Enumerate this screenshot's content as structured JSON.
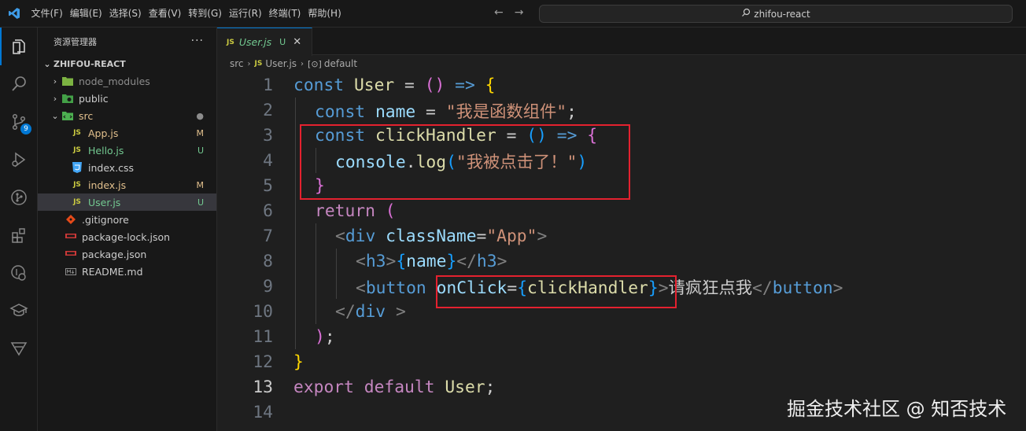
{
  "titlebar": {
    "menu": [
      "文件(F)",
      "编辑(E)",
      "选择(S)",
      "查看(V)",
      "转到(G)",
      "运行(R)",
      "终端(T)",
      "帮助(H)"
    ],
    "search_text": "zhifou-react"
  },
  "activitybar": {
    "source_control_badge": "9"
  },
  "sidebar": {
    "header": "资源管理器",
    "more": "···",
    "section": "ZHIFOU-REACT",
    "items": [
      {
        "label": "node_modules",
        "status": ""
      },
      {
        "label": "public",
        "status": ""
      },
      {
        "label": "src",
        "status": "●"
      },
      {
        "label": "App.js",
        "status": "M"
      },
      {
        "label": "Hello.js",
        "status": "U"
      },
      {
        "label": "index.css",
        "status": ""
      },
      {
        "label": "index.js",
        "status": "M"
      },
      {
        "label": "User.js",
        "status": "U"
      },
      {
        "label": ".gitignore",
        "status": ""
      },
      {
        "label": "package-lock.json",
        "status": ""
      },
      {
        "label": "package.json",
        "status": ""
      },
      {
        "label": "README.md",
        "status": ""
      }
    ]
  },
  "editor": {
    "tab": {
      "icon": "JS",
      "label": "User.js",
      "status": "U"
    },
    "breadcrumb": [
      "src",
      "User.js",
      "default"
    ],
    "line_numbers": [
      "1",
      "2",
      "3",
      "4",
      "5",
      "6",
      "7",
      "8",
      "9",
      "10",
      "11",
      "12",
      "13",
      "14"
    ],
    "code": {
      "l1": {
        "kw": "const",
        "name": "User",
        "eq": " = ",
        "p1": "()",
        "arrow": " => ",
        "brace": "{"
      },
      "l2": {
        "kw": "const",
        "name": "name",
        "eq": " = ",
        "str": "\"我是函数组件\"",
        "semi": ";"
      },
      "l3": {
        "kw": "const",
        "name": "clickHandler",
        "eq": " = ",
        "p1": "()",
        "arrow": " => ",
        "brace": "{"
      },
      "l4": {
        "obj": "console",
        "dot": ".",
        "fn": "log",
        "open": "(",
        "str": "\"我被点击了！\"",
        "close": ")"
      },
      "l5": {
        "brace": "}"
      },
      "l6": {
        "kw": "return",
        "open": " ("
      },
      "l7": {
        "lt": "<",
        "tag": "div",
        "attr": " className",
        "eq": "=",
        "str": "\"App\"",
        "gt": ">"
      },
      "l8": {
        "lt": "<",
        "tag": "h3",
        "gt": ">",
        "ob": "{",
        "var": "name",
        "cb": "}",
        "lt2": "</",
        "tag2": "h3",
        "gt2": ">"
      },
      "l9": {
        "lt": "<",
        "tag": "button",
        "attr": "onClick",
        "eq": "=",
        "ob": "{",
        "var": "clickHandler",
        "cb": "}",
        "gt": ">",
        "text": "请疯狂点我",
        "lt2": "</",
        "tag2": "button",
        "gt2": ">"
      },
      "l10": {
        "lt": "</",
        "tag": "div",
        "gt": " >"
      },
      "l11": {
        "close": ")",
        "semi": ";"
      },
      "l12": {
        "brace": "}"
      },
      "l13": {
        "kw": "export default",
        "name": " User",
        "semi": ";"
      }
    }
  },
  "watermark": "掘金技术社区 @ 知否技术"
}
